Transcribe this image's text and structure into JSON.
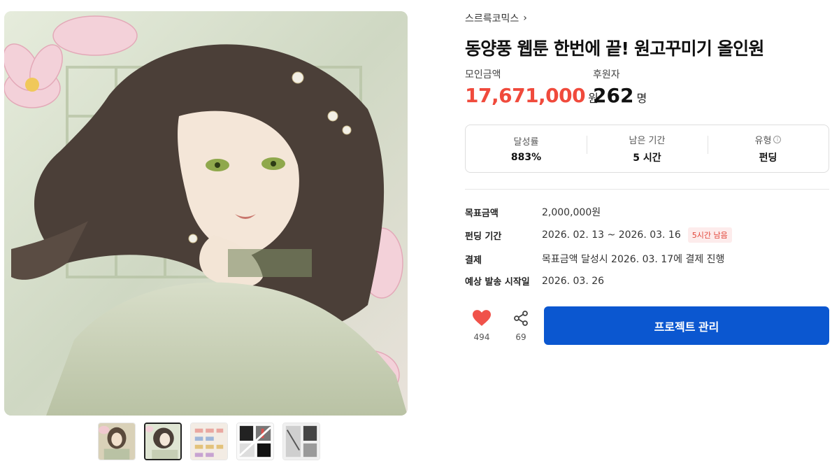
{
  "creator": {
    "name": "스르륵코믹스",
    "chevron": "chevron-right-icon"
  },
  "project": {
    "title": "동양풍 웹툰 한번에 끝! 원고꾸미기 올인원"
  },
  "funding": {
    "amount_label": "모인금액",
    "amount_value": "17,671,000",
    "amount_unit": "원",
    "backers_label": "후원자",
    "backers_value": "262",
    "backers_unit": "명"
  },
  "summary": {
    "rate_label": "달성률",
    "rate_value": "883%",
    "remaining_label": "남은 기간",
    "remaining_value": "5 시간",
    "type_label": "유형",
    "type_value": "펀딩",
    "type_info_icon": "info-icon"
  },
  "details": {
    "goal_label": "목표금액",
    "goal_value": "2,000,000원",
    "period_label": "펀딩 기간",
    "period_value": "2026. 02. 13 ~ 2026. 03. 16",
    "period_badge": "5시간 남음",
    "payment_label": "결제",
    "payment_value": "목표금액 달성시 2026. 03. 17에 결제 진행",
    "ship_label": "예상 발송 시작일",
    "ship_value": "2026. 03. 26"
  },
  "actions": {
    "like_icon": "heart-icon",
    "like_count": "494",
    "share_icon": "share-icon",
    "share_count": "69",
    "manage_label": "프로젝트 관리"
  },
  "colors": {
    "accent_red": "#f04a3c",
    "primary_blue": "#0b57d0",
    "heart": "#f0524a"
  },
  "thumbnails": {
    "count": 5,
    "active_index": 1
  }
}
